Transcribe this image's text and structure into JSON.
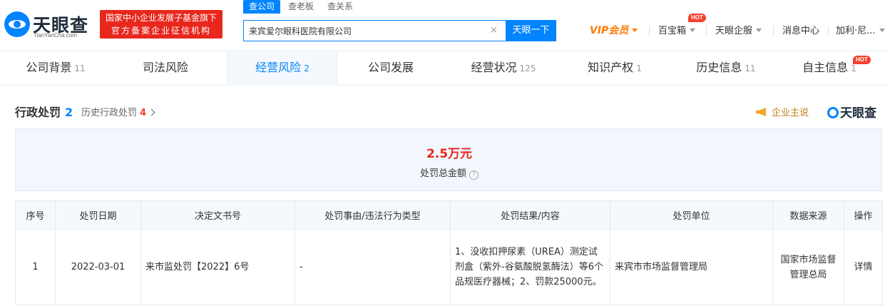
{
  "header": {
    "logo_name": "天眼查",
    "logo_domain": "TianYanCha.com",
    "fund_badge": [
      "国家中小企业发展子基金旗下",
      "官方备案企业征信机构"
    ],
    "search_tabs": [
      "查公司",
      "查老板",
      "查关系"
    ],
    "search_value": "来宾爱尔眼科医院有限公司",
    "search_button": "天眼一下",
    "nav": {
      "vip": "VIP会员",
      "toolbox": "百宝箱",
      "enterprise": "天眼企服",
      "messages": "消息中心",
      "user": "加利·尼..."
    },
    "hot": "HOT"
  },
  "tabs": [
    {
      "label": "公司背景",
      "count": "11"
    },
    {
      "label": "司法风险",
      "count": ""
    },
    {
      "label": "经营风险",
      "count": "2"
    },
    {
      "label": "公司发展",
      "count": ""
    },
    {
      "label": "经营状况",
      "count": "125"
    },
    {
      "label": "知识产权",
      "count": "1"
    },
    {
      "label": "历史信息",
      "count": "11"
    },
    {
      "label": "自主信息",
      "count": "1"
    }
  ],
  "section": {
    "title": "行政处罚",
    "count": "2",
    "history_label": "历史行政处罚",
    "history_count": "4",
    "promo": "企业主说",
    "brand": "天眼查"
  },
  "summary": {
    "value": "2.5万元",
    "label": "处罚总金额",
    "help": "?"
  },
  "table": {
    "headers": [
      "序号",
      "处罚日期",
      "决定文书号",
      "处罚事由/违法行为类型",
      "处罚结果/内容",
      "处罚单位",
      "数据来源",
      "操作"
    ],
    "rows": [
      {
        "index": "1",
        "date": "2022-03-01",
        "doc_no": "来市监处罚【2022】6号",
        "reason": "-",
        "result": "1、没收扣押尿素（UREA）测定试剂盒（紫外-谷氨酸脱氢酶法）等6个品规医疗器械；2、罚款25000元。",
        "unit": "来宾市市场监督管理局",
        "source": "国家市场监督管理总局",
        "action": "详情"
      }
    ]
  }
}
